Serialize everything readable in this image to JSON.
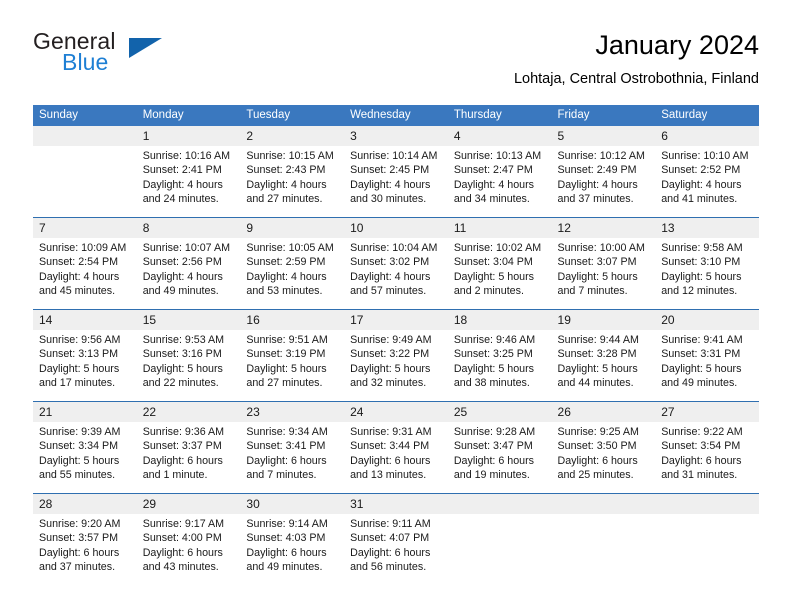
{
  "brand": {
    "name_part1": "General",
    "name_part2": "Blue"
  },
  "header": {
    "title": "January 2024",
    "location": "Lohtaja, Central Ostrobothnia, Finland"
  },
  "weekday_headers": [
    "Sunday",
    "Monday",
    "Tuesday",
    "Wednesday",
    "Thursday",
    "Friday",
    "Saturday"
  ],
  "colors": {
    "header_blue": "#3a78bf",
    "row_divider_blue": "#2f6fb0",
    "daynum_band": "#efefef",
    "brand_blue": "#1e7fd4",
    "triangle_blue": "#1263ab"
  },
  "weeks": [
    [
      {
        "day": "",
        "sunrise": "",
        "sunset": "",
        "daylight1": "",
        "daylight2": ""
      },
      {
        "day": "1",
        "sunrise": "Sunrise: 10:16 AM",
        "sunset": "Sunset: 2:41 PM",
        "daylight1": "Daylight: 4 hours",
        "daylight2": "and 24 minutes."
      },
      {
        "day": "2",
        "sunrise": "Sunrise: 10:15 AM",
        "sunset": "Sunset: 2:43 PM",
        "daylight1": "Daylight: 4 hours",
        "daylight2": "and 27 minutes."
      },
      {
        "day": "3",
        "sunrise": "Sunrise: 10:14 AM",
        "sunset": "Sunset: 2:45 PM",
        "daylight1": "Daylight: 4 hours",
        "daylight2": "and 30 minutes."
      },
      {
        "day": "4",
        "sunrise": "Sunrise: 10:13 AM",
        "sunset": "Sunset: 2:47 PM",
        "daylight1": "Daylight: 4 hours",
        "daylight2": "and 34 minutes."
      },
      {
        "day": "5",
        "sunrise": "Sunrise: 10:12 AM",
        "sunset": "Sunset: 2:49 PM",
        "daylight1": "Daylight: 4 hours",
        "daylight2": "and 37 minutes."
      },
      {
        "day": "6",
        "sunrise": "Sunrise: 10:10 AM",
        "sunset": "Sunset: 2:52 PM",
        "daylight1": "Daylight: 4 hours",
        "daylight2": "and 41 minutes."
      }
    ],
    [
      {
        "day": "7",
        "sunrise": "Sunrise: 10:09 AM",
        "sunset": "Sunset: 2:54 PM",
        "daylight1": "Daylight: 4 hours",
        "daylight2": "and 45 minutes."
      },
      {
        "day": "8",
        "sunrise": "Sunrise: 10:07 AM",
        "sunset": "Sunset: 2:56 PM",
        "daylight1": "Daylight: 4 hours",
        "daylight2": "and 49 minutes."
      },
      {
        "day": "9",
        "sunrise": "Sunrise: 10:05 AM",
        "sunset": "Sunset: 2:59 PM",
        "daylight1": "Daylight: 4 hours",
        "daylight2": "and 53 minutes."
      },
      {
        "day": "10",
        "sunrise": "Sunrise: 10:04 AM",
        "sunset": "Sunset: 3:02 PM",
        "daylight1": "Daylight: 4 hours",
        "daylight2": "and 57 minutes."
      },
      {
        "day": "11",
        "sunrise": "Sunrise: 10:02 AM",
        "sunset": "Sunset: 3:04 PM",
        "daylight1": "Daylight: 5 hours",
        "daylight2": "and 2 minutes."
      },
      {
        "day": "12",
        "sunrise": "Sunrise: 10:00 AM",
        "sunset": "Sunset: 3:07 PM",
        "daylight1": "Daylight: 5 hours",
        "daylight2": "and 7 minutes."
      },
      {
        "day": "13",
        "sunrise": "Sunrise: 9:58 AM",
        "sunset": "Sunset: 3:10 PM",
        "daylight1": "Daylight: 5 hours",
        "daylight2": "and 12 minutes."
      }
    ],
    [
      {
        "day": "14",
        "sunrise": "Sunrise: 9:56 AM",
        "sunset": "Sunset: 3:13 PM",
        "daylight1": "Daylight: 5 hours",
        "daylight2": "and 17 minutes."
      },
      {
        "day": "15",
        "sunrise": "Sunrise: 9:53 AM",
        "sunset": "Sunset: 3:16 PM",
        "daylight1": "Daylight: 5 hours",
        "daylight2": "and 22 minutes."
      },
      {
        "day": "16",
        "sunrise": "Sunrise: 9:51 AM",
        "sunset": "Sunset: 3:19 PM",
        "daylight1": "Daylight: 5 hours",
        "daylight2": "and 27 minutes."
      },
      {
        "day": "17",
        "sunrise": "Sunrise: 9:49 AM",
        "sunset": "Sunset: 3:22 PM",
        "daylight1": "Daylight: 5 hours",
        "daylight2": "and 32 minutes."
      },
      {
        "day": "18",
        "sunrise": "Sunrise: 9:46 AM",
        "sunset": "Sunset: 3:25 PM",
        "daylight1": "Daylight: 5 hours",
        "daylight2": "and 38 minutes."
      },
      {
        "day": "19",
        "sunrise": "Sunrise: 9:44 AM",
        "sunset": "Sunset: 3:28 PM",
        "daylight1": "Daylight: 5 hours",
        "daylight2": "and 44 minutes."
      },
      {
        "day": "20",
        "sunrise": "Sunrise: 9:41 AM",
        "sunset": "Sunset: 3:31 PM",
        "daylight1": "Daylight: 5 hours",
        "daylight2": "and 49 minutes."
      }
    ],
    [
      {
        "day": "21",
        "sunrise": "Sunrise: 9:39 AM",
        "sunset": "Sunset: 3:34 PM",
        "daylight1": "Daylight: 5 hours",
        "daylight2": "and 55 minutes."
      },
      {
        "day": "22",
        "sunrise": "Sunrise: 9:36 AM",
        "sunset": "Sunset: 3:37 PM",
        "daylight1": "Daylight: 6 hours",
        "daylight2": "and 1 minute."
      },
      {
        "day": "23",
        "sunrise": "Sunrise: 9:34 AM",
        "sunset": "Sunset: 3:41 PM",
        "daylight1": "Daylight: 6 hours",
        "daylight2": "and 7 minutes."
      },
      {
        "day": "24",
        "sunrise": "Sunrise: 9:31 AM",
        "sunset": "Sunset: 3:44 PM",
        "daylight1": "Daylight: 6 hours",
        "daylight2": "and 13 minutes."
      },
      {
        "day": "25",
        "sunrise": "Sunrise: 9:28 AM",
        "sunset": "Sunset: 3:47 PM",
        "daylight1": "Daylight: 6 hours",
        "daylight2": "and 19 minutes."
      },
      {
        "day": "26",
        "sunrise": "Sunrise: 9:25 AM",
        "sunset": "Sunset: 3:50 PM",
        "daylight1": "Daylight: 6 hours",
        "daylight2": "and 25 minutes."
      },
      {
        "day": "27",
        "sunrise": "Sunrise: 9:22 AM",
        "sunset": "Sunset: 3:54 PM",
        "daylight1": "Daylight: 6 hours",
        "daylight2": "and 31 minutes."
      }
    ],
    [
      {
        "day": "28",
        "sunrise": "Sunrise: 9:20 AM",
        "sunset": "Sunset: 3:57 PM",
        "daylight1": "Daylight: 6 hours",
        "daylight2": "and 37 minutes."
      },
      {
        "day": "29",
        "sunrise": "Sunrise: 9:17 AM",
        "sunset": "Sunset: 4:00 PM",
        "daylight1": "Daylight: 6 hours",
        "daylight2": "and 43 minutes."
      },
      {
        "day": "30",
        "sunrise": "Sunrise: 9:14 AM",
        "sunset": "Sunset: 4:03 PM",
        "daylight1": "Daylight: 6 hours",
        "daylight2": "and 49 minutes."
      },
      {
        "day": "31",
        "sunrise": "Sunrise: 9:11 AM",
        "sunset": "Sunset: 4:07 PM",
        "daylight1": "Daylight: 6 hours",
        "daylight2": "and 56 minutes."
      },
      {
        "day": "",
        "sunrise": "",
        "sunset": "",
        "daylight1": "",
        "daylight2": ""
      },
      {
        "day": "",
        "sunrise": "",
        "sunset": "",
        "daylight1": "",
        "daylight2": ""
      },
      {
        "day": "",
        "sunrise": "",
        "sunset": "",
        "daylight1": "",
        "daylight2": ""
      }
    ]
  ]
}
